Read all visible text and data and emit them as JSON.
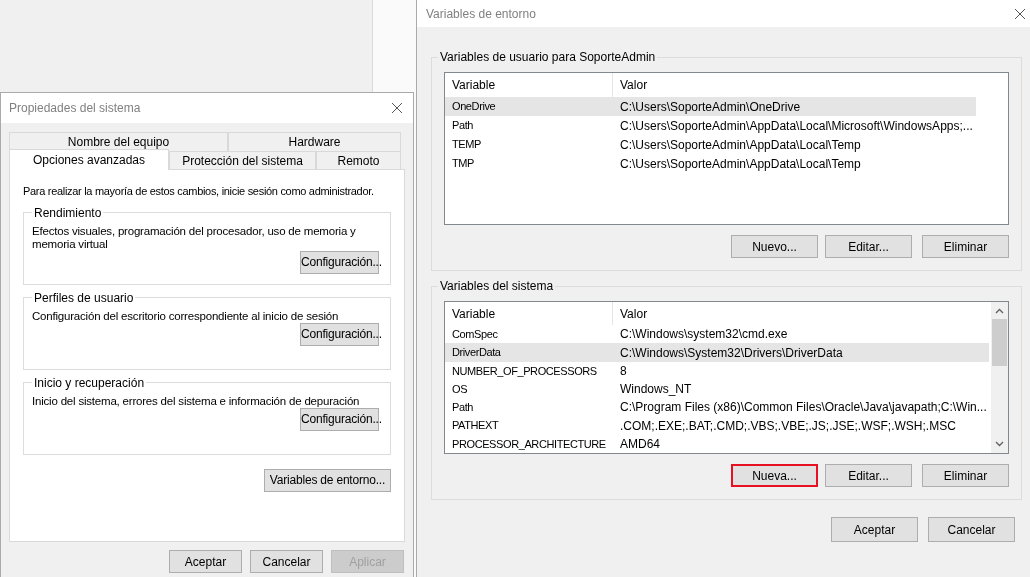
{
  "system_properties": {
    "title": "Propiedades del sistema",
    "tab_rows": [
      [
        {
          "label": "Nombre del equipo",
          "selected": false
        },
        {
          "label": "Hardware",
          "selected": false
        }
      ],
      [
        {
          "label": "Opciones avanzadas",
          "selected": true
        },
        {
          "label": "Protección del sistema",
          "selected": false
        },
        {
          "label": "Remoto",
          "selected": false
        }
      ]
    ],
    "notice": "Para realizar la mayoría de estos cambios, inicie sesión como administrador.",
    "groups": [
      {
        "title": "Rendimiento",
        "description": "Efectos visuales, programación del procesador, uso de memoria y memoria virtual",
        "button": "Configuración..."
      },
      {
        "title": "Perfiles de usuario",
        "description": "Configuración del escritorio correspondiente al inicio de sesión",
        "button": "Configuración..."
      },
      {
        "title": "Inicio y recuperación",
        "description": "Inicio del sistema, errores del sistema e información de depuración",
        "button": "Configuración..."
      }
    ],
    "env_button": "Variables de entorno...",
    "buttons": [
      {
        "label": "Aceptar",
        "disabled": false
      },
      {
        "label": "Cancelar",
        "disabled": false
      },
      {
        "label": "Aplicar",
        "disabled": true
      }
    ]
  },
  "environment_variables": {
    "title": "Variables de entorno",
    "user_group": {
      "title": "Variables de usuario para SoporteAdmin",
      "columns": [
        "Variable",
        "Valor"
      ],
      "rows": [
        {
          "variable": "OneDrive",
          "value": "C:\\Users\\SoporteAdmin\\OneDrive",
          "selected": true
        },
        {
          "variable": "Path",
          "value": "C:\\Users\\SoporteAdmin\\AppData\\Local\\Microsoft\\WindowsApps;...",
          "selected": false
        },
        {
          "variable": "TEMP",
          "value": "C:\\Users\\SoporteAdmin\\AppData\\Local\\Temp",
          "selected": false
        },
        {
          "variable": "TMP",
          "value": "C:\\Users\\SoporteAdmin\\AppData\\Local\\Temp",
          "selected": false
        }
      ],
      "buttons": [
        {
          "label": "Nuevo...",
          "highlighted": false
        },
        {
          "label": "Editar...",
          "highlighted": false
        },
        {
          "label": "Eliminar",
          "highlighted": false
        }
      ]
    },
    "system_group": {
      "title": "Variables del sistema",
      "columns": [
        "Variable",
        "Valor"
      ],
      "rows": [
        {
          "variable": "ComSpec",
          "value": "C:\\Windows\\system32\\cmd.exe",
          "selected": false
        },
        {
          "variable": "DriverData",
          "value": "C:\\Windows\\System32\\Drivers\\DriverData",
          "selected": true
        },
        {
          "variable": "NUMBER_OF_PROCESSORS",
          "value": "8",
          "selected": false
        },
        {
          "variable": "OS",
          "value": "Windows_NT",
          "selected": false
        },
        {
          "variable": "Path",
          "value": "C:\\Program Files (x86)\\Common Files\\Oracle\\Java\\javapath;C:\\Win...",
          "selected": false
        },
        {
          "variable": "PATHEXT",
          "value": ".COM;.EXE;.BAT;.CMD;.VBS;.VBE;.JS;.JSE;.WSF;.WSH;.MSC",
          "selected": false
        },
        {
          "variable": "PROCESSOR_ARCHITECTURE",
          "value": "AMD64",
          "selected": false
        }
      ],
      "buttons": [
        {
          "label": "Nueva...",
          "highlighted": true
        },
        {
          "label": "Editar...",
          "highlighted": false
        },
        {
          "label": "Eliminar",
          "highlighted": false
        }
      ]
    },
    "buttons": [
      "Aceptar",
      "Cancelar"
    ]
  }
}
